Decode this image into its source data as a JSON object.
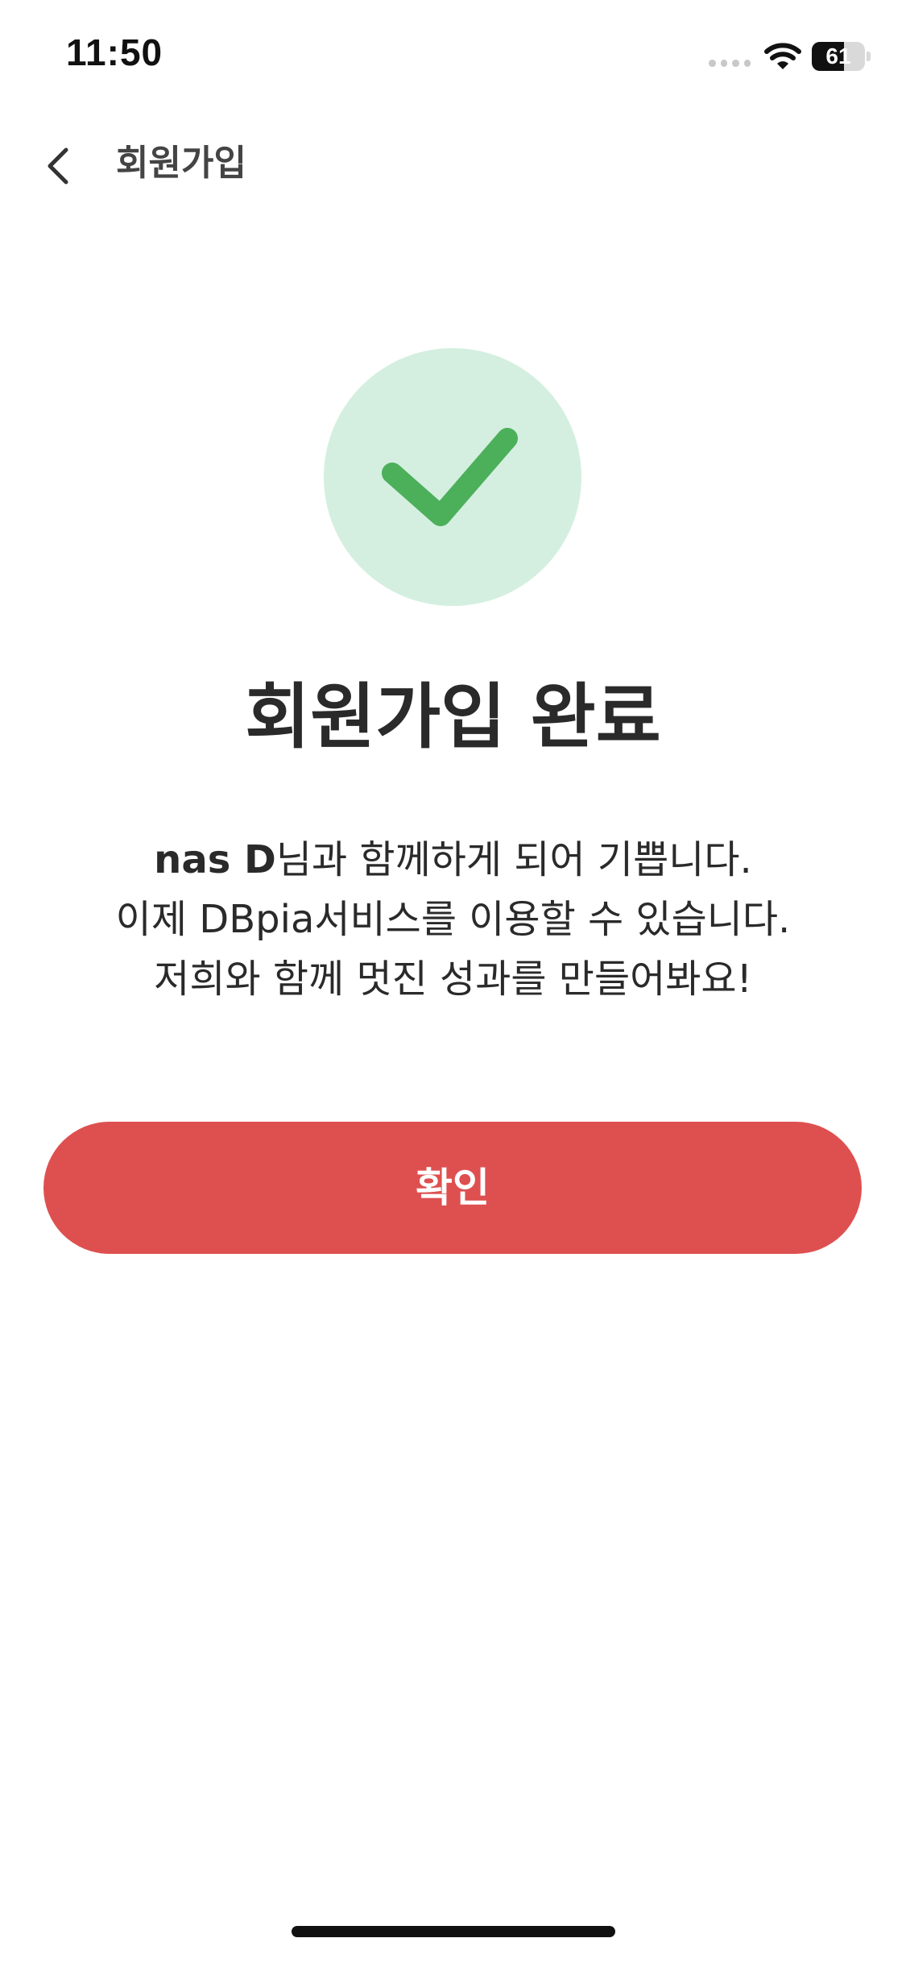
{
  "status_bar": {
    "time": "11:50",
    "battery_level": "61",
    "battery_fraction": 0.61,
    "icons": [
      "signal-dots-icon",
      "wifi-icon",
      "battery-icon"
    ]
  },
  "nav": {
    "back_icon": "chevron-left-icon",
    "title": "회원가입"
  },
  "success": {
    "icon": "check-icon",
    "circle_color": "#d4efe0",
    "check_color": "#4caf5a"
  },
  "main": {
    "title": "회원가입 완료",
    "message": {
      "user_name": "nas D",
      "line1_suffix": "님과 함께하게 되어 기쁩니다.",
      "line2": "이제 DBpia서비스를 이용할 수 있습니다.",
      "line3": "저희와 함께 멋진 성과를 만들어봐요!"
    }
  },
  "confirm_button": {
    "label": "확인",
    "color": "#de5050"
  }
}
